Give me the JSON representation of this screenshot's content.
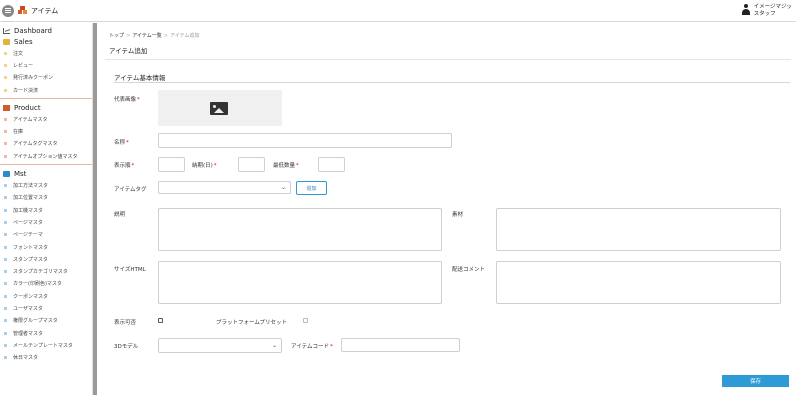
{
  "header": {
    "app_title": "アイテム",
    "user_name": "イメージマジッ",
    "user_role": "スタッフ"
  },
  "sidebar": {
    "dashboard": "Dashboard",
    "sales": {
      "title": "Sales",
      "items": [
        "注文",
        "レビュー",
        "発行済みクーポン",
        "カード決済"
      ]
    },
    "product": {
      "title": "Product",
      "items": [
        "アイテムマスタ",
        "在庫",
        "アイテムタグマスタ",
        "アイテムオプション値マスタ"
      ]
    },
    "mst": {
      "title": "Mst",
      "items": [
        "加工方法マスタ",
        "加工位置マスタ",
        "加工機マスタ",
        "ページマスタ",
        "ページテーマ",
        "フォントマスタ",
        "スタンプマスタ",
        "スタンプカテゴリマスタ",
        "カラー(印刷色)マスタ",
        "クーポンマスタ",
        "ユーザマスタ",
        "権限グループマスタ",
        "管理者マスタ",
        "メールテンプレートマスタ",
        "休日マスタ"
      ]
    }
  },
  "breadcrumb": {
    "top": "トップ",
    "list": "アイテム一覧",
    "current": "アイテム追加",
    "sep": ">"
  },
  "page": {
    "title": "アイテム追加",
    "section_title": "アイテム基本情報"
  },
  "form": {
    "image_label": "代表画像",
    "name_label": "名称",
    "order_label": "表示順",
    "leadtime_label": "納期(日)",
    "minqty_label": "最低数量",
    "tag_label": "アイテムタグ",
    "add_button": "追加",
    "description_label": "説明",
    "material_label": "素材",
    "size_html_label": "サイズHTML",
    "shipping_comment_label": "配送コメント",
    "visible_label": "表示可否",
    "platform_preset_label": "プラットフォームプリセット",
    "model3d_label": "3Dモデル",
    "item_code_label": "アイテムコード",
    "required_mark": "*",
    "save_button": "保存"
  },
  "colors": {
    "accent": "#2e9bd6",
    "required": "#d0021b",
    "product_icon": "#d35a2a",
    "sales_icon": "#e2b23a",
    "mst_icon": "#2e8bc9"
  }
}
